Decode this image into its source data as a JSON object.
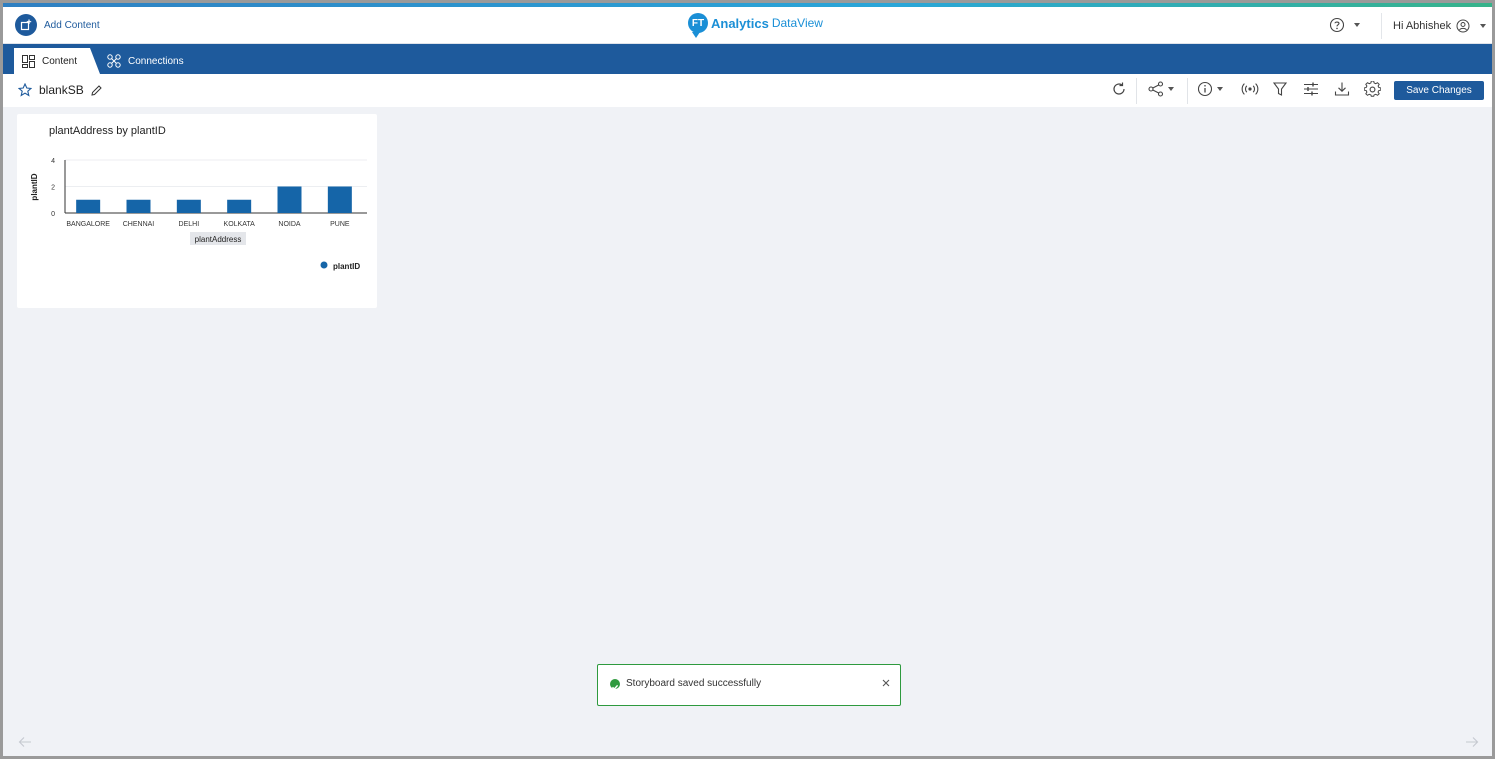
{
  "header": {
    "add_content_label": "Add Content",
    "brand_name": "Analytics",
    "brand_suffix": "DataView",
    "brand_badge": "FT",
    "user_greeting": "Hi Abhishek"
  },
  "tabs": [
    {
      "label": "Content",
      "active": true
    },
    {
      "label": "Connections",
      "active": false
    }
  ],
  "storyboard": {
    "name": "blankSB",
    "save_label": "Save Changes"
  },
  "colors": {
    "brand_blue": "#1e5a9c",
    "bar_color": "#1565a8",
    "success_green": "#2e9a3e"
  },
  "chart_card": {
    "title": "plantAddress by plantID"
  },
  "chart_data": {
    "type": "bar",
    "title": "plantAddress by plantID",
    "xlabel": "plantAddress",
    "ylabel": "plantID",
    "categories": [
      "BANGALORE",
      "CHENNAI",
      "DELHI",
      "KOLKATA",
      "NOIDA",
      "PUNE"
    ],
    "series": [
      {
        "name": "plantID",
        "values": [
          1,
          1,
          1,
          1,
          2,
          2
        ]
      }
    ],
    "ylim": [
      0,
      4
    ],
    "yticks": [
      0,
      2,
      4
    ],
    "grid": true,
    "legend": "bottom-right"
  },
  "toast": {
    "message": "Storyboard saved successfully"
  },
  "icons": {
    "add": "add-content-icon",
    "help": "help-icon",
    "user": "user-avatar-icon",
    "refresh": "refresh-icon",
    "share": "share-icon",
    "info": "info-icon",
    "broadcast": "broadcast-icon",
    "filter": "filter-icon",
    "sliders": "sliders-icon",
    "download": "download-icon",
    "settings": "gear-icon"
  }
}
